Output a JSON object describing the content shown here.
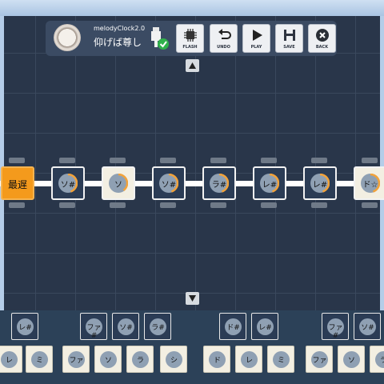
{
  "app": {
    "title": "melodyClock2.0",
    "song": "仰げば尊し"
  },
  "toolbar": {
    "buttons": [
      {
        "label": "FLASH",
        "icon": "chip-icon"
      },
      {
        "label": "UNDO",
        "icon": "undo-icon"
      },
      {
        "label": "PLAY",
        "icon": "play-icon"
      },
      {
        "label": "SAVE",
        "icon": "save-icon"
      },
      {
        "label": "BACK",
        "icon": "close-icon"
      }
    ],
    "usb_status": "connected"
  },
  "sequence": {
    "start_label": "最遅",
    "notes": [
      {
        "label": "ソ#",
        "style": "dark",
        "fill": 0.45
      },
      {
        "label": "ソ",
        "style": "light",
        "fill": 0.4
      },
      {
        "label": "ソ#",
        "style": "dark",
        "fill": 0.45
      },
      {
        "label": "ラ#",
        "style": "dark",
        "fill": 0.45
      },
      {
        "label": "レ#",
        "style": "dark",
        "fill": 0.45
      },
      {
        "label": "レ#",
        "style": "dark",
        "fill": 0.45
      },
      {
        "label": "ド☆",
        "style": "light",
        "fill": 0.45
      }
    ]
  },
  "palette": {
    "upper": [
      "レ#",
      "ファ#",
      "ソ#",
      "ラ#",
      "ド#",
      "レ#",
      "ファ#",
      "ソ#"
    ],
    "lower": [
      "レ",
      "ミ",
      "ファ",
      "ソ",
      "ラ",
      "シ",
      "ド",
      "レ",
      "ミ",
      "ファ",
      "ソ",
      "ラ"
    ]
  },
  "colors": {
    "accent": "#f49a1c",
    "arc": "#f2a23a",
    "check": "#2fb14a",
    "canvas": "#29364a"
  }
}
